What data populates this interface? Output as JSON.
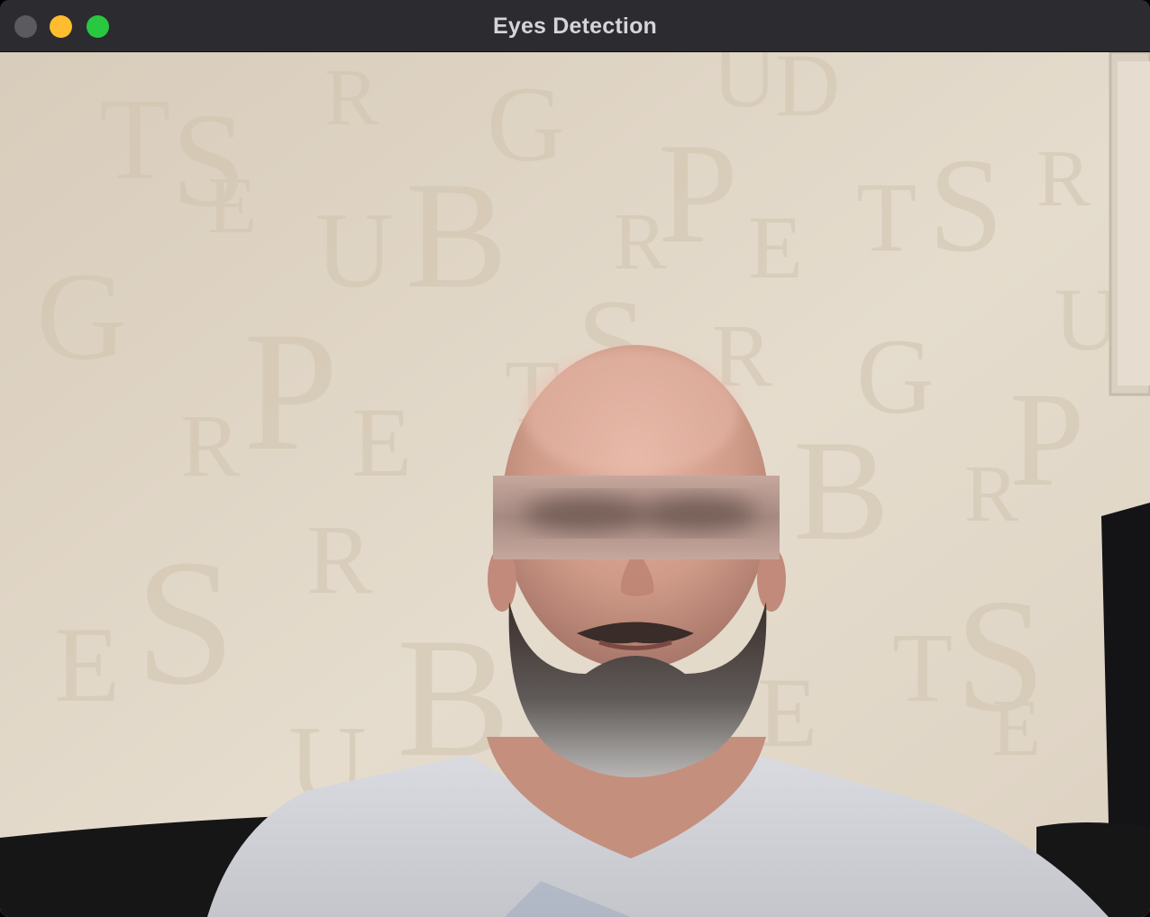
{
  "window": {
    "title": "Eyes Detection",
    "controls": {
      "close": "close-button",
      "minimize": "minimize-button",
      "zoom": "zoom-button"
    }
  },
  "colors": {
    "titlebar": "#2c2b30",
    "close_inactive": "#5b5a5f",
    "minimize": "#febc2e",
    "zoom": "#28c840",
    "wall": "#e3d9c9"
  }
}
